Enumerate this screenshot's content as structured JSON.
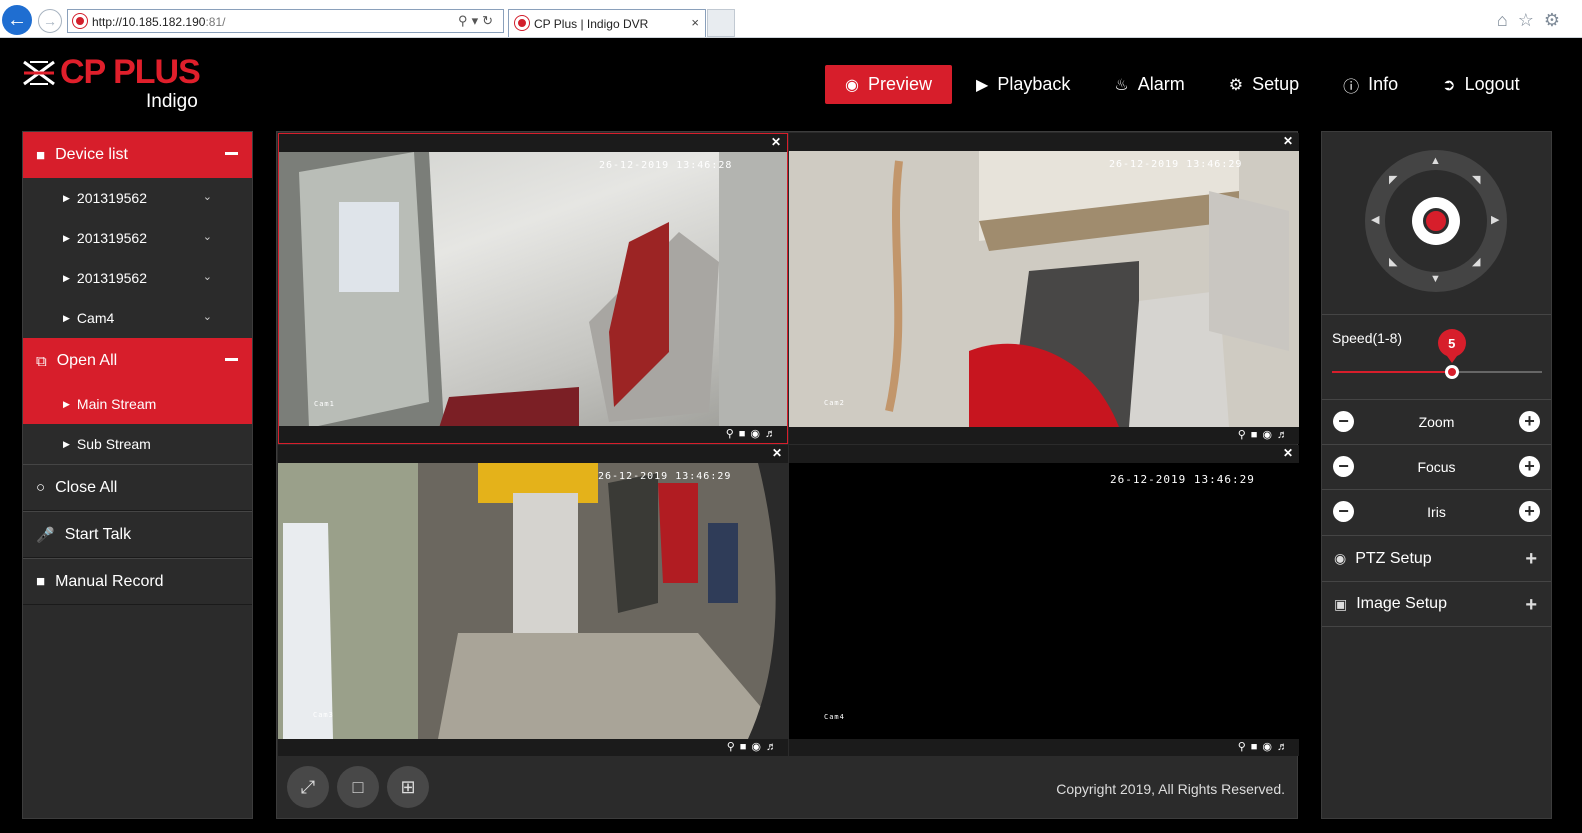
{
  "browser": {
    "url_host": "http://10.185.182.190",
    "url_port": ":81/",
    "tab_title": "CP Plus | Indigo DVR",
    "tab_close": "×"
  },
  "brand": {
    "name": "CP PLUS",
    "product": "Indigo",
    "accent": "#d71e2b"
  },
  "nav": [
    {
      "label": "Preview",
      "icon": "eye-icon",
      "active": true
    },
    {
      "label": "Playback",
      "icon": "play-icon"
    },
    {
      "label": "Alarm",
      "icon": "bell-icon"
    },
    {
      "label": "Setup",
      "icon": "gear-icon"
    },
    {
      "label": "Info",
      "icon": "info-icon"
    },
    {
      "label": "Logout",
      "icon": "logout-icon"
    }
  ],
  "sidebar": {
    "device_list": "Device list",
    "devices": [
      "201319562",
      "201319562",
      "201319562",
      "Cam4"
    ],
    "open_all": "Open All",
    "main_stream": "Main Stream",
    "sub_stream": "Sub Stream",
    "close_all": "Close All",
    "start_talk": "Start Talk",
    "manual_record": "Manual Record"
  },
  "cameras": [
    {
      "timestamp": "26-12-2019 13:46:28",
      "label": "Cam1",
      "selected": true
    },
    {
      "timestamp": "26-12-2019 13:46:29",
      "label": "Cam2"
    },
    {
      "timestamp": "26-12-2019 13:46:29",
      "label": "Cam3"
    },
    {
      "timestamp": "26-12-2019 13:46:29",
      "label": "Cam4"
    }
  ],
  "footer": {
    "copyright": "Copyright 2019, All Rights Reserved."
  },
  "ptz": {
    "speed_label": "Speed(1-8)",
    "speed_value": "5",
    "speed_fraction": 0.57,
    "zoom": "Zoom",
    "focus": "Focus",
    "iris": "Iris",
    "ptz_setup": "PTZ Setup",
    "image_setup": "Image Setup"
  }
}
